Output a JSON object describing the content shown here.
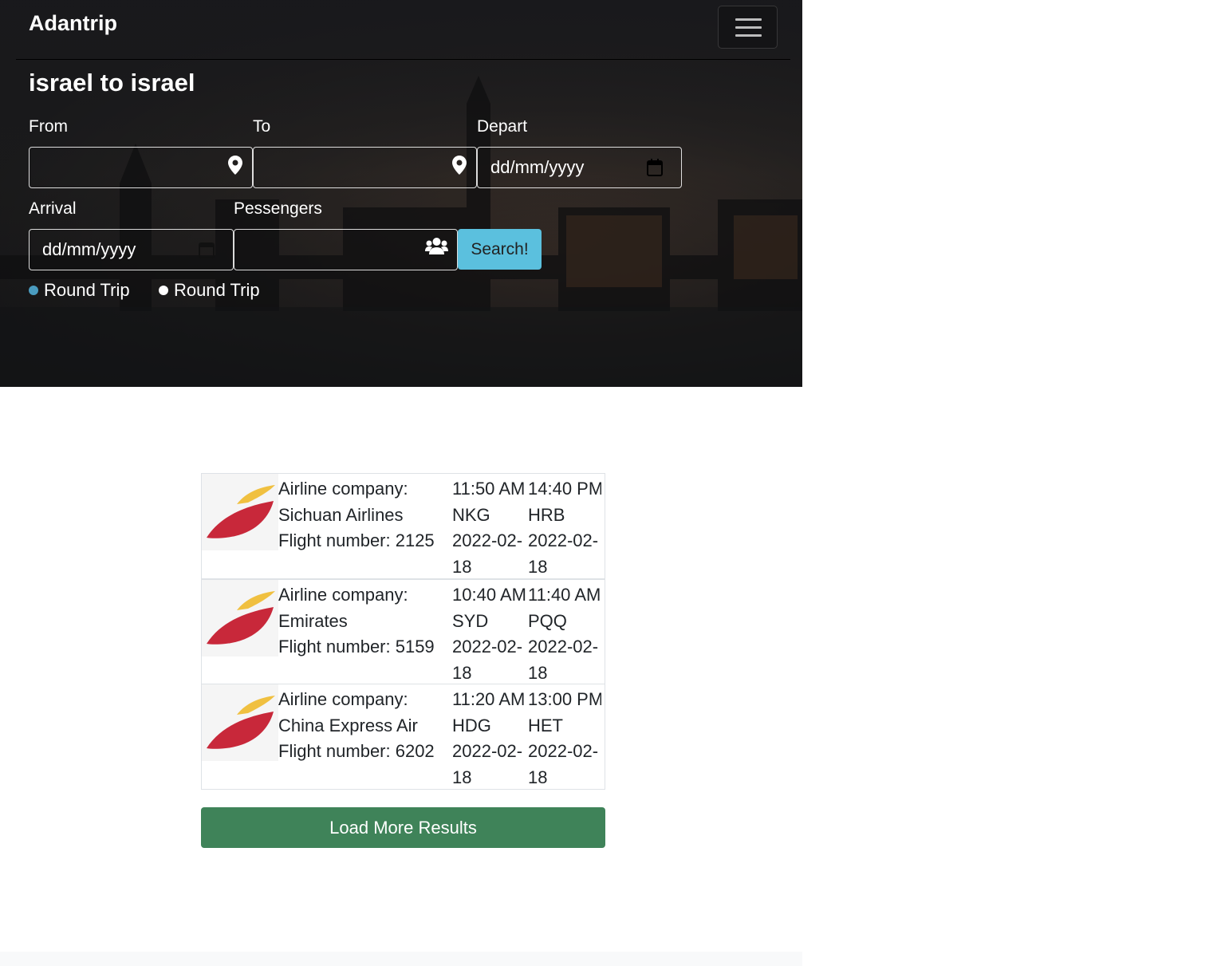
{
  "navbar": {
    "brand": "Adantrip"
  },
  "search": {
    "title": "israel to israel",
    "from_label": "From",
    "to_label": "To",
    "depart_label": "Depart",
    "depart_placeholder": "dd/mm/yyyy",
    "arrival_label": "Arrival",
    "arrival_placeholder": "dd/mm/yyyy",
    "passengers_label": "Pessengers",
    "search_button": "Search!",
    "trip_options": [
      {
        "label": "Round Trip",
        "color": "#4a9cc0"
      },
      {
        "label": "Round Trip",
        "color": "#ffffff"
      }
    ]
  },
  "results": [
    {
      "company_label": "Airline company:",
      "company": "Sichuan Airlines",
      "flight_number": "Flight number: 2125",
      "depart_time": "11:50 AM",
      "depart_airport": "NKG",
      "depart_date_a": "2022-02-",
      "depart_date_b": "18",
      "arrive_time": "14:40 PM",
      "arrive_airport": "HRB",
      "arrive_date_a": "2022-02-",
      "arrive_date_b": "18"
    },
    {
      "company_label": "Airline company:",
      "company": "Emirates",
      "flight_number": "Flight number: 5159",
      "depart_time": "10:40 AM",
      "depart_airport": "SYD",
      "depart_date_a": "2022-02-",
      "depart_date_b": "18",
      "arrive_time": "11:40 AM",
      "arrive_airport": "PQQ",
      "arrive_date_a": "2022-02-",
      "arrive_date_b": "18"
    },
    {
      "company_label": "Airline company:",
      "company": "China Express Air",
      "flight_number": "Flight number: 6202",
      "depart_time": "11:20 AM",
      "depart_airport": "HDG",
      "depart_date_a": "2022-02-",
      "depart_date_b": "18",
      "arrive_time": "13:00 PM",
      "arrive_airport": "HET",
      "arrive_date_a": "2022-02-",
      "arrive_date_b": "18"
    }
  ],
  "load_more": "Load More Results",
  "colors": {
    "search_button": "#5bc0de",
    "load_more": "#3f8359",
    "logo_red": "#c8283a",
    "logo_yellow": "#f0c040"
  }
}
